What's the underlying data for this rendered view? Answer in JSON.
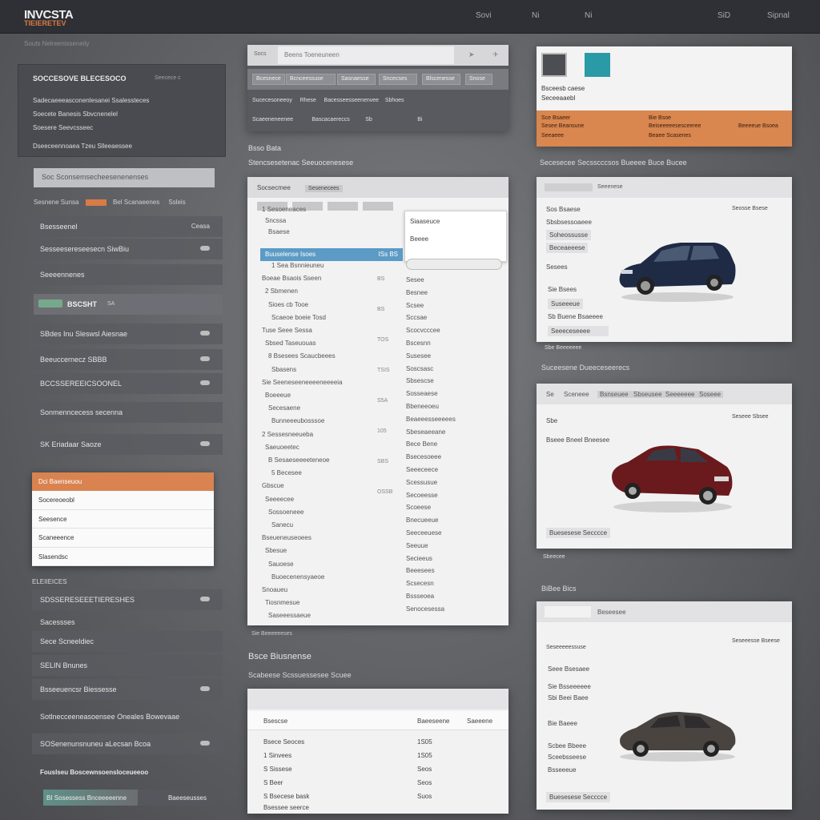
{
  "header": {
    "logo": "INVCSTA",
    "logo_sub": "TIEIERETEV",
    "nav": [
      "Sovi",
      "Ni",
      "Ni",
      "SiD",
      "Sipnal"
    ]
  },
  "breadcrumb": "Souts Nelreenisseneily",
  "sidebar": {
    "panel_title": "SOCCESOVE BLECESOCO",
    "panel_subtitle": "Seecece c",
    "lines": [
      "Sadecaeeeasconenlesanei Ssalessteces",
      "Soecete Banesis Sbvcnenelel",
      "Soesere Seevcsseec",
      "Dseeceennoaea Tzeu Slleeaessee"
    ],
    "search_placeholder": "Soc Sconsemsecheesenenenses",
    "filter_left": "Sesnene Sunsa",
    "filter_mid": "Bel Scanaeenes",
    "filter_right": "Ssleis",
    "rows": [
      {
        "label": "Bsesseenel",
        "value": "Ceasa"
      },
      {
        "label": "Sesseesereseesecn SiwBiu",
        "value": ""
      },
      {
        "label": "Seeeennenes",
        "value": ""
      }
    ],
    "toggle_label": "BSCSHT",
    "toggle_hint": "SA",
    "items": [
      "SBdes Inu Sleswsl Aiesnae",
      "Beeuccernecz SBBB",
      "BCCSSEREEICSOONEL",
      "Sonmenncecess secenna",
      "SK Eriadaar Saoze"
    ],
    "dropdown": {
      "header": "Dci Baenseuou",
      "items": [
        "Socereoeobl",
        "Seesence",
        "Scaneeence",
        "Slasendsc"
      ]
    },
    "section": "ELEIIEICES",
    "lower_items": [
      "SDSSERESEEETIERESHES",
      "Sacessses",
      "Sece Scneeldiec",
      "SELIN Bnunes",
      "Bsseeuencsr Biessesse",
      "Sotlnecceeneasoensee Oneales Bowevaae",
      "SOSenenunsnuneu aLecsan Bcoa"
    ],
    "footer_title": "Fouslseu Boscewnsoensloceueeoo",
    "progress": {
      "left": "BI Sosessess Bnceeeeenne",
      "right": "Baeeseusses",
      "value": 0.55
    }
  },
  "middle": {
    "toolbar_label": "Socs",
    "address": "Beens Toeneuneen",
    "tabs": [
      "Bcesnece",
      "Bcnceessuse",
      "Sasnaesse",
      "Sncecses",
      "Blscenesse",
      "Snose"
    ],
    "row1": [
      "Sucecesoneeoy",
      "Rhese",
      "Bacesseesseenenvee",
      "Sbhoes"
    ],
    "row2": [
      "Scaeeneneenee",
      "Bascacaereccs",
      "Sb",
      "Bi"
    ],
    "section1": "Bsso Bata",
    "section1_sub": "Stencsesetenac Seeuocenesese",
    "tree_header": "Socsecmee",
    "tree_header_input": "Sesenecees",
    "popup": [
      "Siaaseuce",
      "Beeee"
    ],
    "selected": {
      "label": "Buuselense Isoes",
      "value": "ISs BS"
    },
    "tree_items": [
      "1 Sesoeneaces",
      "Sncssa",
      "Bsaese",
      "1 Sea Bsnnieuneu",
      "Boeae Bsaois Sseen",
      "2 Sbmenen",
      "Sioes cb Tooe",
      "Scaeoe boeie Tosd",
      "Tuse Seee Sessa",
      "Sbsed Taseuouas",
      "8 Bsesees Scaucbeees",
      "Sbasens",
      "Sie Seeneseeneeeeneeeeia",
      "Boeeeue",
      "Secesaene",
      "Bunneeeubosssoe",
      "2 Sessesneeueba",
      "Saeuoeetec",
      "B Sesaeseeeeteneoe",
      "5 Becesee",
      "Gbscue",
      "Seeeecee",
      "Sossoeneee",
      "Sanecu",
      "Bseueneuseoees",
      "Sbesue",
      "Sauoese",
      "Buoecenensyaeoe",
      "Snoaueu",
      "Tiosnmesue",
      "Saseeessaeue"
    ],
    "tree_values": [
      "BS",
      "BS",
      "TOS",
      "TSIS",
      "S5A",
      "105",
      "SBS",
      "OSSB"
    ],
    "tree_right": [
      "Sesee",
      "Besnee",
      "Scsee",
      "Sccsae",
      "Scocvcccee",
      "Bscesnn",
      "Susesee",
      "Soscsasc",
      "Sbsescse",
      "Sosseaese",
      "Bbeneeoeu",
      "Beaeeesseeeees",
      "Sbeseaeeane",
      "Bece Bene",
      "Bsecesoeee",
      "Seeeceece",
      "Scessusue",
      "Secoeesse",
      "Scoeese",
      "Bnecueeue",
      "Seeceeuese",
      "Seeuue",
      "Secieeus",
      "Beeesees",
      "Scsecesn",
      "Bssseoea",
      "Senocesessa"
    ],
    "tree_caption": "Sie Beeeeeeses",
    "section2": "Bsce Biusnense",
    "section3": "Scabeese Scssuessesee Scuee",
    "list_header": {
      "left": "Bsescse",
      "mid": "Baeeseene",
      "right": "Saeeene"
    },
    "list_items": [
      {
        "label": "Bsece Seoces",
        "value": "1S05"
      },
      {
        "label": "1 Sinvees",
        "value": "1S05"
      },
      {
        "label": "S Sissese",
        "value": "Seos"
      },
      {
        "label": "S Beer",
        "value": "Seos"
      },
      {
        "label": "S Bsecese bask",
        "value": "Suos"
      },
      {
        "label": "Bsessee seerce",
        "value": ""
      }
    ]
  },
  "right": {
    "top": {
      "title1": "Bsceesb caese",
      "title2": "Seceeaaebl",
      "orange_col1": [
        "Sce Bsaeer",
        "Sesee Beansune",
        "Seeaeee"
      ],
      "orange_col2": [
        "Bie Bsoe",
        "Beiseeeeesesceeree",
        "Beaee Scasenes"
      ],
      "orange_col3": "Beeeeue Bsoea"
    },
    "section1": "Secesecee Secsscccsos  Bueeee Buce Bucee",
    "card1": {
      "header": "Seeenese",
      "corner": "Seosse  Bsese",
      "lines": [
        "Sos Bsaese",
        "Sbsbsessoaeee",
        "Soheossusse",
        "Beceaeeese",
        "Sesees",
        "Sie Bsees",
        "Suseeeue",
        "Sb Buene Bsaeeee",
        "Seeeceseeee"
      ],
      "caption": "Sbe Beeeeeee"
    },
    "section2": "Suceesene Dueeceseerecs",
    "card2": {
      "tabs": [
        "Se",
        "Sceneee",
        "Bsnseuee",
        "Sbseusee",
        "Seeeeeee",
        "Soseee"
      ],
      "lines": [
        "Sbe",
        "Bseee Bneel Bneesee"
      ],
      "corner": "Seseee  Sbsee",
      "button": "Buesesese Secccce",
      "caption": "Sbeecee"
    },
    "section3": "BiBee Bics",
    "card3": {
      "header": "Beseesee",
      "lines": [
        "Seseeeeessuse",
        "Seee Bsesaee",
        "Sie Bsseeeeee",
        "Sbi Beei Baee",
        "Bie Baeee",
        "Scbee Bbeee",
        "Buesesese Secccce",
        "Sceebsseese",
        "Bsseeeue"
      ],
      "corner": "Seseeesse Bseese",
      "button": "Buesesese Secccce"
    }
  },
  "colors": {
    "accent": "#d9864f",
    "selection": "#5b9bc6",
    "topbar": "#2f3035"
  }
}
